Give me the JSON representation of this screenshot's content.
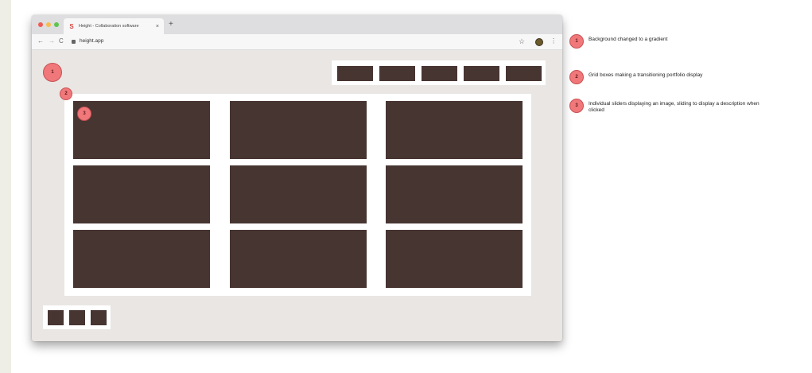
{
  "browser": {
    "tab_title": "Height - Collaboration software",
    "tab_favicon": "S",
    "tab_close": "×",
    "new_tab": "+",
    "url": "height.app",
    "back_icon": "←",
    "forward_icon": "→",
    "reload_icon": "C",
    "star_icon": "☆",
    "menu_icon": "⋮"
  },
  "annotations": {
    "markers": [
      "1",
      "2",
      "3"
    ],
    "legend": [
      {
        "number": "1",
        "text": "Background changed to a gradient"
      },
      {
        "number": "2",
        "text": "Grid boxes making a transitioning portfolio display"
      },
      {
        "number": "3",
        "text": "Individual sliders displaying an image, sliding to display a description when clicked"
      }
    ]
  },
  "colors": {
    "box": "#473532",
    "marker": "#f0787a",
    "window_bg": "#e9e6e3"
  }
}
